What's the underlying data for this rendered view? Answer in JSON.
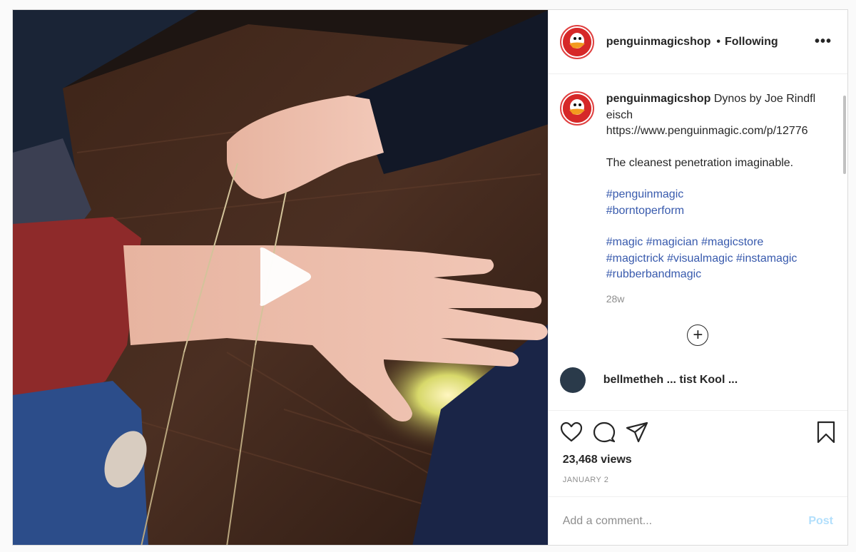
{
  "header": {
    "username": "penguinmagicshop",
    "separator": "•",
    "follow_status": "Following",
    "more_icon": "more-horizontal-icon"
  },
  "caption": {
    "username": "penguinmagicshop",
    "title": "Dynos by Joe Rindfleisch",
    "url": "https://www.penguinmagic.com/p/12776",
    "tagline": "The cleanest penetration imaginable.",
    "tags_line1": [
      "#penguinmagic"
    ],
    "tags_line2": [
      "#borntoperform"
    ],
    "tags_line3": [
      "#magic",
      "#magician",
      "#magicstore"
    ],
    "tags_line4": [
      "#magictrick",
      "#visualmagic",
      "#instamagic"
    ],
    "tags_line5": [
      "#rubberbandmagic"
    ],
    "age": "28w"
  },
  "partial_comment": {
    "text": "bellmetheh ... tist Kool ..."
  },
  "actions": {
    "views": "23,468 views",
    "date": "JANUARY 2"
  },
  "comment_box": {
    "placeholder": "Add a comment...",
    "post_label": "Post"
  },
  "colors": {
    "link": "#385aad",
    "post_disabled": "#b2dffc",
    "avatar_ring": "#e04040"
  }
}
